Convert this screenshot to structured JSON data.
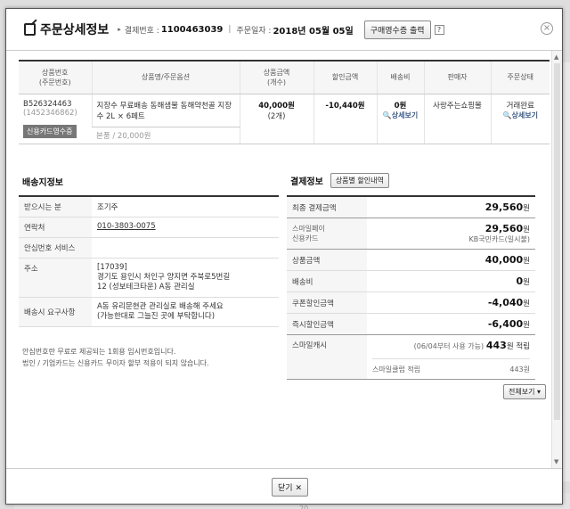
{
  "background": {
    "bottom_text": "20... 20... ..."
  },
  "header": {
    "title": "주문상세정보",
    "payment_no_label": "결제번호 :",
    "payment_no": "1100463039",
    "order_date_label": "주문일자 :",
    "order_date": "2018년 05월 05일",
    "receipt_button": "구매영수증 출력",
    "help": "?",
    "close": "×"
  },
  "products": {
    "columns": [
      "상품번호\n(주문번호)",
      "상품명/주문옵션",
      "상품금액\n(개수)",
      "할인금액",
      "배송비",
      "판매자",
      "주문상태"
    ],
    "rows": [
      {
        "product_no": "B526324463",
        "order_no": "(1452346862)",
        "card_receipt": "신용카드영수증",
        "name": "지장수 무료배송 동해샘물 동해약천골 지장수 2L × 6페트",
        "option": "본품 / 20,000원",
        "price": "40,000원",
        "qty": "(2개)",
        "discount": "-10,440원",
        "shipping": "0원",
        "shipping_detail": "상세보기",
        "seller": "사랑주는쇼핑몰",
        "status": "거래완료",
        "status_detail": "상세보기"
      }
    ]
  },
  "shipping": {
    "title": "배송지정보",
    "rows": [
      {
        "key": "받으시는 분",
        "value": "조기주"
      },
      {
        "key": "연락처",
        "value": "010-3803-0075"
      },
      {
        "key": "안심번호 서비스",
        "value": ""
      },
      {
        "key": "주소",
        "value": "[17039]\n경기도 용인시 처인구 양지면 주북로5번길\n12 (성보테크타운) A동 관리실"
      },
      {
        "key": "배송시 요구사항",
        "value": "A동 유리문현관 관리실로 배송해 주세요\n(가능한대로 그늘진 곳에 부탁합니다)"
      }
    ],
    "notes": [
      "안심번호란 무료로 제공되는 1회용 임시번호입니다.",
      "법인 / 기업카드는 신용카드 무이자 할부 적용이 되지 않습니다."
    ]
  },
  "payment": {
    "title": "결제정보",
    "discount_button": "상품별 할인내역",
    "final_label": "최종 결제금액",
    "final_value": "29,560",
    "method_label1": "스마일페이",
    "method_label2": "신용카드",
    "method_value": "29,560",
    "method_card": "KB국민카드(일시불)",
    "product_label": "상품금액",
    "product_value": "40,000",
    "shipping_label": "배송비",
    "shipping_value": "0",
    "coupon_label": "쿠폰할인금액",
    "coupon_value": "-4,040",
    "instant_label": "즉시할인금액",
    "instant_value": "-6,400",
    "smilecash_label": "스마일캐시",
    "smilecash_note": "(06/04부터 사용 가능)",
    "smilecash_value": "443",
    "smilecash_unit": "원 적립",
    "smileclub_label": "스마일클럽 적립",
    "smileclub_value": "443원",
    "won": "원",
    "more_button": "전체보기"
  },
  "footer": {
    "close_button": "닫기"
  }
}
